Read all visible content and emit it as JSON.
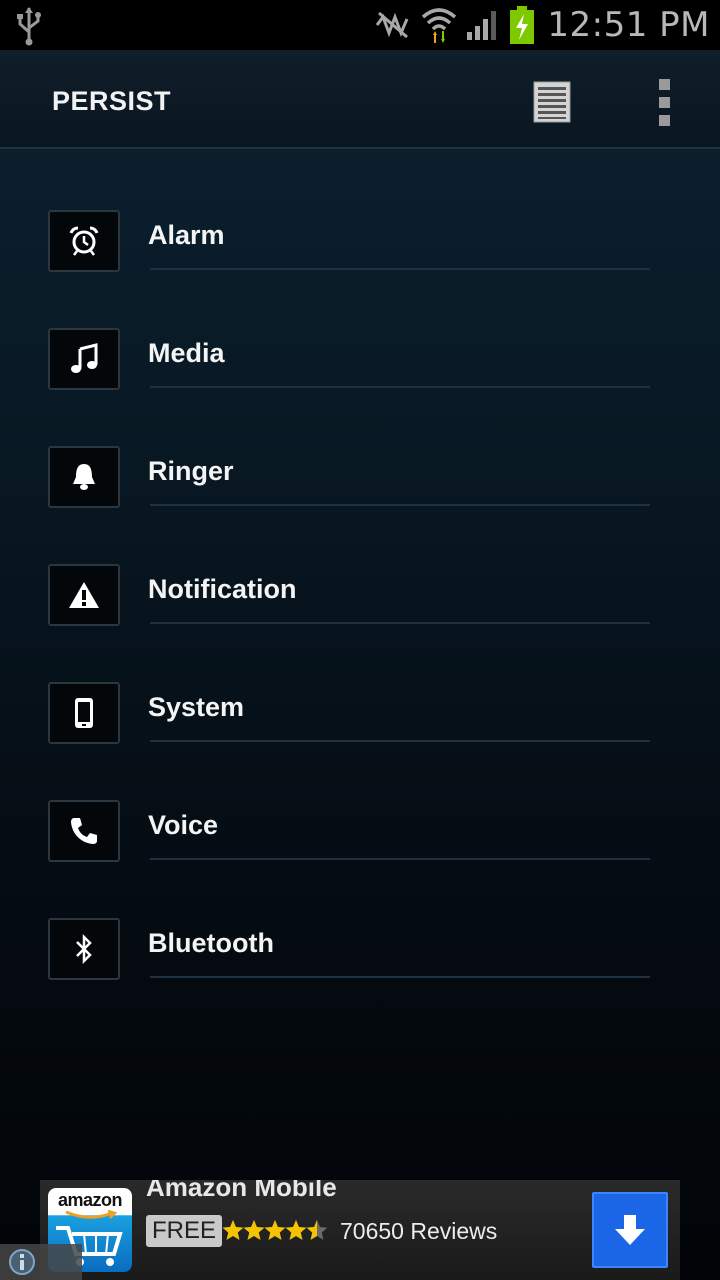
{
  "status_bar": {
    "time": "12:51 PM",
    "icons": [
      "usb-icon",
      "sync-muted-icon",
      "wifi-icon",
      "signal-icon",
      "battery-charging-icon"
    ]
  },
  "action_bar": {
    "title": "PERSIST",
    "actions": [
      "log-list-icon",
      "overflow-menu-icon"
    ]
  },
  "items": [
    {
      "label": "Alarm",
      "icon": "alarm-clock-icon"
    },
    {
      "label": "Media",
      "icon": "music-note-icon"
    },
    {
      "label": "Ringer",
      "icon": "bell-icon"
    },
    {
      "label": "Notification",
      "icon": "warning-icon"
    },
    {
      "label": "System",
      "icon": "phone-device-icon"
    },
    {
      "label": "Voice",
      "icon": "phone-handset-icon"
    },
    {
      "label": "Bluetooth",
      "icon": "bluetooth-icon"
    }
  ],
  "ad": {
    "logo_text": "amazon",
    "title": "Amazon Mobile",
    "price": "FREE",
    "rating": 4.5,
    "reviews": "70650 Reviews"
  },
  "colors": {
    "accent": "#1a66e6",
    "star": "#f5c400",
    "battery": "#7ec800"
  }
}
